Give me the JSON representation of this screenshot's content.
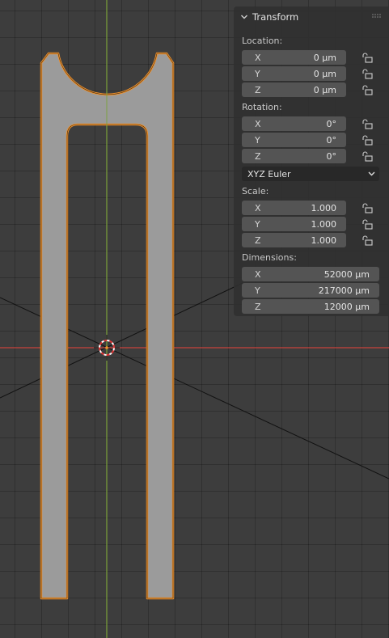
{
  "panel": {
    "title": "Transform",
    "location": {
      "label": "Location:",
      "rows": [
        {
          "axis": "X",
          "value": "0 µm"
        },
        {
          "axis": "Y",
          "value": "0 µm"
        },
        {
          "axis": "Z",
          "value": "0 µm"
        }
      ]
    },
    "rotation": {
      "label": "Rotation:",
      "rows": [
        {
          "axis": "X",
          "value": "0°"
        },
        {
          "axis": "Y",
          "value": "0°"
        },
        {
          "axis": "Z",
          "value": "0°"
        }
      ]
    },
    "rotation_mode": "XYZ Euler",
    "scale": {
      "label": "Scale:",
      "rows": [
        {
          "axis": "X",
          "value": "1.000"
        },
        {
          "axis": "Y",
          "value": "1.000"
        },
        {
          "axis": "Z",
          "value": "1.000"
        }
      ]
    },
    "dimensions": {
      "label": "Dimensions:",
      "rows": [
        {
          "axis": "X",
          "value": "52000 µm"
        },
        {
          "axis": "Y",
          "value": "217000 µm"
        },
        {
          "axis": "Z",
          "value": "12000 µm"
        }
      ]
    }
  },
  "colors": {
    "grid_background": "#3d3d3d",
    "object_fill": "#9b9b9b",
    "selection_outline": "#f0922e",
    "x_axis": "#c8423c",
    "y_axis": "#7aa13a",
    "panel_bg": "#303030",
    "field_bg": "#545454"
  },
  "icons": {
    "collapse": "chevron-down-icon",
    "drag": "grip-icon",
    "lock": "unlocked-padlock-icon",
    "cursor": "3d-cursor-icon",
    "dropdown": "chevron-down-icon"
  }
}
